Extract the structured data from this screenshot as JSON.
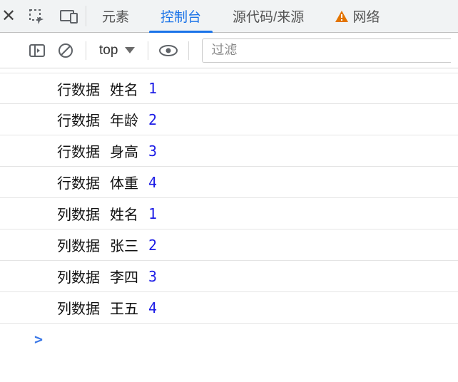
{
  "tabs": {
    "elements": "元素",
    "console": "控制台",
    "sources": "源代码/来源",
    "network": "网络"
  },
  "active_tab": "console",
  "toolbar": {
    "context": "top",
    "filter_placeholder": "过滤"
  },
  "logs": [
    {
      "a1": "行数据",
      "a2": "姓名",
      "a3": "1"
    },
    {
      "a1": "行数据",
      "a2": "年龄",
      "a3": "2"
    },
    {
      "a1": "行数据",
      "a2": "身高",
      "a3": "3"
    },
    {
      "a1": "行数据",
      "a2": "体重",
      "a3": "4"
    },
    {
      "a1": "列数据",
      "a2": "姓名",
      "a3": "1"
    },
    {
      "a1": "列数据",
      "a2": "张三",
      "a3": "2"
    },
    {
      "a1": "列数据",
      "a2": "李四",
      "a3": "3"
    },
    {
      "a1": "列数据",
      "a2": "王五",
      "a3": "4"
    }
  ],
  "prompt": ">"
}
